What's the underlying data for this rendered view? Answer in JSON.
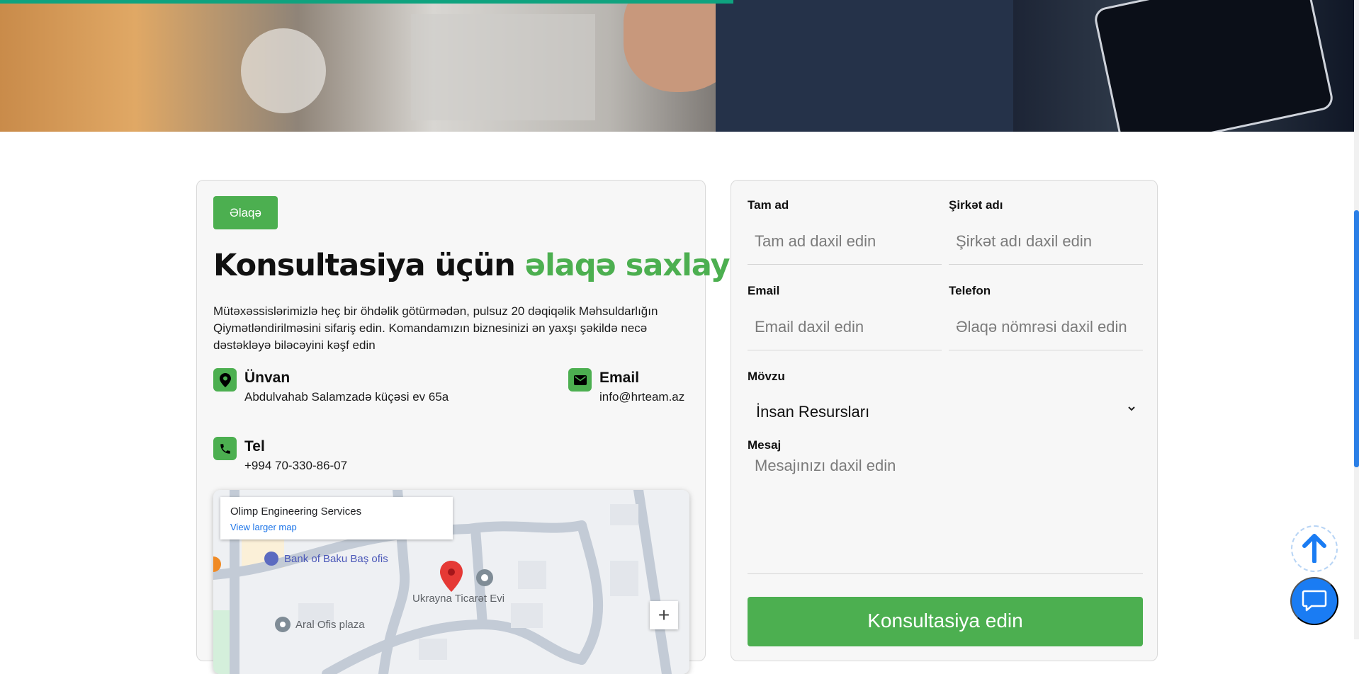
{
  "colors": {
    "accent": "#4caf50",
    "progress": "#0fa37f",
    "scroll_thumb": "#2b7fe6",
    "chat_button": "#1a7cf3"
  },
  "contact": {
    "badge": "Əlaqə",
    "heading_main": "Konsultasiya üçün",
    "heading_accent": "əlaqə saxlayın",
    "description": "Mütəxəssislərimizlə heç bir öhdəlik götürmədən, pulsuz 20 dəqiqəlik Məhsuldarlığın Qiymətləndirilməsini sifariş edin. Komandamızın biznesinizi ən yaxşı şəkildə necə dəstəkləyə biləcəyini kəşf edin",
    "address": {
      "icon": "location-pin-icon",
      "label": "Ünvan",
      "value": "Abdulvahab Salamzadə küçəsi ev 65a"
    },
    "email": {
      "icon": "mail-icon",
      "label": "Email",
      "value": "info@hrteam.az"
    },
    "phone": {
      "icon": "phone-icon",
      "label": "Tel",
      "value": "+994 70-330-86-07"
    }
  },
  "map": {
    "place_name": "Olimp Engineering Services",
    "larger_map_link": "View larger map",
    "poi_1": "Bank of Baku Baş ofis",
    "poi_2": "Ukrayna Ticarət Evi",
    "poi_3": "Aral Ofis plaza",
    "zoom_in": "+"
  },
  "form": {
    "full_name": {
      "label": "Tam ad",
      "placeholder": "Tam ad daxil edin"
    },
    "company": {
      "label": "Şirkət adı",
      "placeholder": "Şirkət adı daxil edin"
    },
    "email": {
      "label": "Email",
      "placeholder": "Email daxil edin"
    },
    "phone": {
      "label": "Telefon",
      "placeholder": "Əlaqə nömrəsi daxil edin"
    },
    "subject": {
      "label": "Mövzu",
      "selected": "İnsan Resursları"
    },
    "message": {
      "label": "Mesaj",
      "placeholder": "Mesajınızı daxil edin"
    },
    "submit_label": "Konsultasiya edin"
  },
  "floating": {
    "to_top_icon": "arrow-up-icon",
    "chat_icon": "chat-bubble-icon"
  }
}
